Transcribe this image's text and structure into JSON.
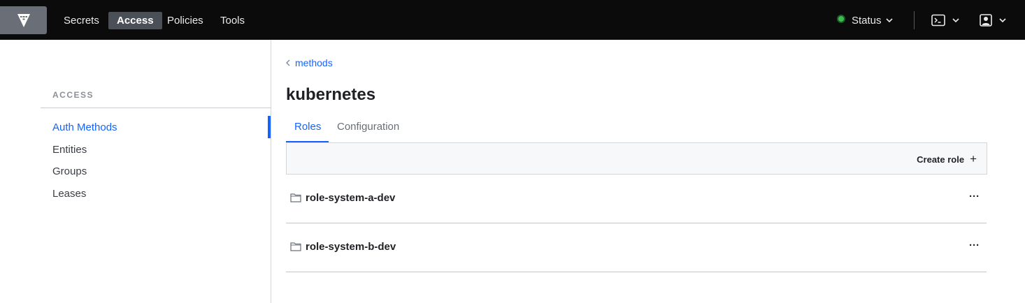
{
  "nav": {
    "items": [
      {
        "label": "Secrets",
        "active": false
      },
      {
        "label": "Access",
        "active": true
      },
      {
        "label": "Policies",
        "active": false
      },
      {
        "label": "Tools",
        "active": false
      }
    ],
    "status_label": "Status",
    "status_color": "#3dbb4f"
  },
  "sidebar": {
    "heading": "ACCESS",
    "items": [
      {
        "label": "Auth Methods",
        "active": true
      },
      {
        "label": "Entities",
        "active": false
      },
      {
        "label": "Groups",
        "active": false
      },
      {
        "label": "Leases",
        "active": false
      }
    ]
  },
  "main": {
    "breadcrumb": "methods",
    "title": "kubernetes",
    "tabs": [
      {
        "label": "Roles",
        "active": true
      },
      {
        "label": "Configuration",
        "active": false
      }
    ],
    "create_label": "Create role",
    "rows": [
      {
        "label": "role-system-a-dev",
        "icon": "folder-icon"
      },
      {
        "label": "role-system-b-dev",
        "icon": "folder-icon"
      }
    ]
  },
  "colors": {
    "accent": "#1563ff",
    "topbar": "#0b0b0c"
  }
}
